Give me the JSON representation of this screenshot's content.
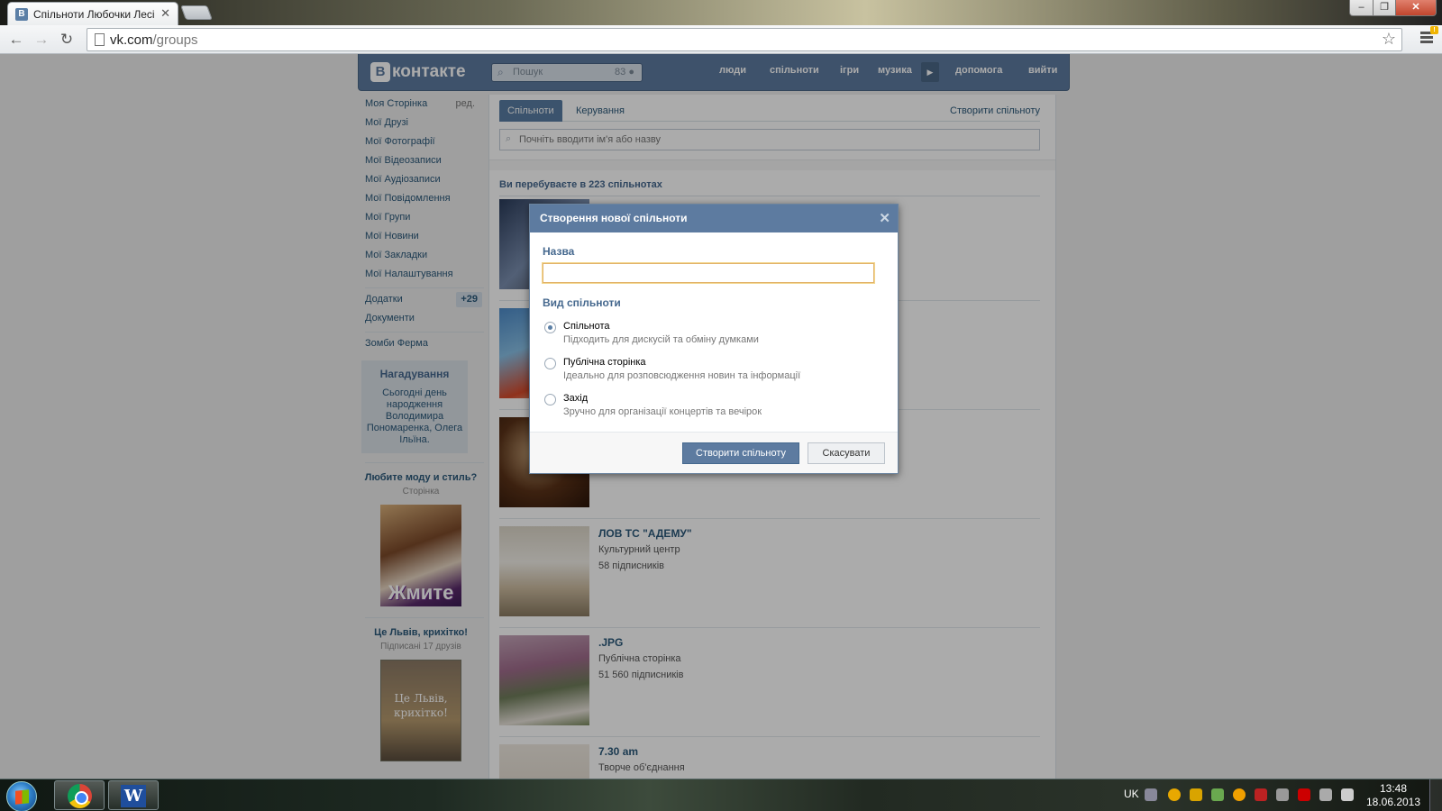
{
  "browser": {
    "tab_title": "Спільноти Любочки Лесі",
    "tab_favicon": "В",
    "url_domain": "vk.com",
    "url_path": "/groups"
  },
  "vk": {
    "logo_box": "В",
    "logo_text": "контакте",
    "search_placeholder": "Пошук",
    "search_count": "83",
    "nav": [
      "люди",
      "спільноти",
      "ігри",
      "музика",
      "допомога",
      "вийти"
    ]
  },
  "left_menu": {
    "items": [
      {
        "label": "Моя Сторінка",
        "extra": "ред."
      },
      {
        "label": "Мої Друзі"
      },
      {
        "label": "Мої Фотографії"
      },
      {
        "label": "Мої Відеозаписи"
      },
      {
        "label": "Мої Аудіозаписи"
      },
      {
        "label": "Мої Повідомлення"
      },
      {
        "label": "Мої Групи"
      },
      {
        "label": "Мої Новини"
      },
      {
        "label": "Мої Закладки"
      },
      {
        "label": "Мої Налаштування"
      }
    ],
    "apps_label": "Додатки",
    "apps_badge": "+29",
    "docs_label": "Документи",
    "game_label": "Зомби Ферма",
    "reminder": {
      "title": "Нагадування",
      "body": "Сьогодні день народження Володимира Пономаренка, Олега Ільїна."
    },
    "ad1": {
      "title": "Любите моду и стиль?",
      "sub": "Сторінка",
      "image_text": "Жмите"
    },
    "ad2": {
      "title": "Це Львів, крихітко!",
      "sub": "Підписані 17 друзів",
      "image_text": "Це Львів, крихітко!"
    }
  },
  "main": {
    "tab_groups": "Спільноти",
    "tab_manage": "Керування",
    "create_link": "Створити спільноту",
    "search_placeholder": "Почніть вводити ім'я або назву",
    "summary": "Ви перебуваєте в 223 спільнотах",
    "groups": [
      {
        "name": "ЛОВ ТС \"АДЕМУ\"",
        "type": "Культурний центр",
        "subs": "58 підписників"
      },
      {
        "name": ".JPG",
        "type": "Публічна сторінка",
        "subs": "51 560 підписників"
      },
      {
        "name": "7.30 am",
        "type": "Творче об'єднання",
        "subs": ""
      }
    ]
  },
  "modal": {
    "title": "Створення нової спільноти",
    "name_label": "Назва",
    "name_value": "",
    "kind_label": "Вид спільноти",
    "options": [
      {
        "title": "Спільнота",
        "desc": "Підходить для дискусій та обміну думками",
        "selected": true
      },
      {
        "title": "Публічна сторінка",
        "desc": "Ідеально для розповсюдження новин та інформації",
        "selected": false
      },
      {
        "title": "Захід",
        "desc": "Зручно для організації концертів та вечірок",
        "selected": false
      }
    ],
    "create_button": "Створити спільноту",
    "cancel_button": "Скасувати"
  },
  "taskbar": {
    "lang": "UK",
    "time": "13:48",
    "date": "18.06.2013"
  }
}
